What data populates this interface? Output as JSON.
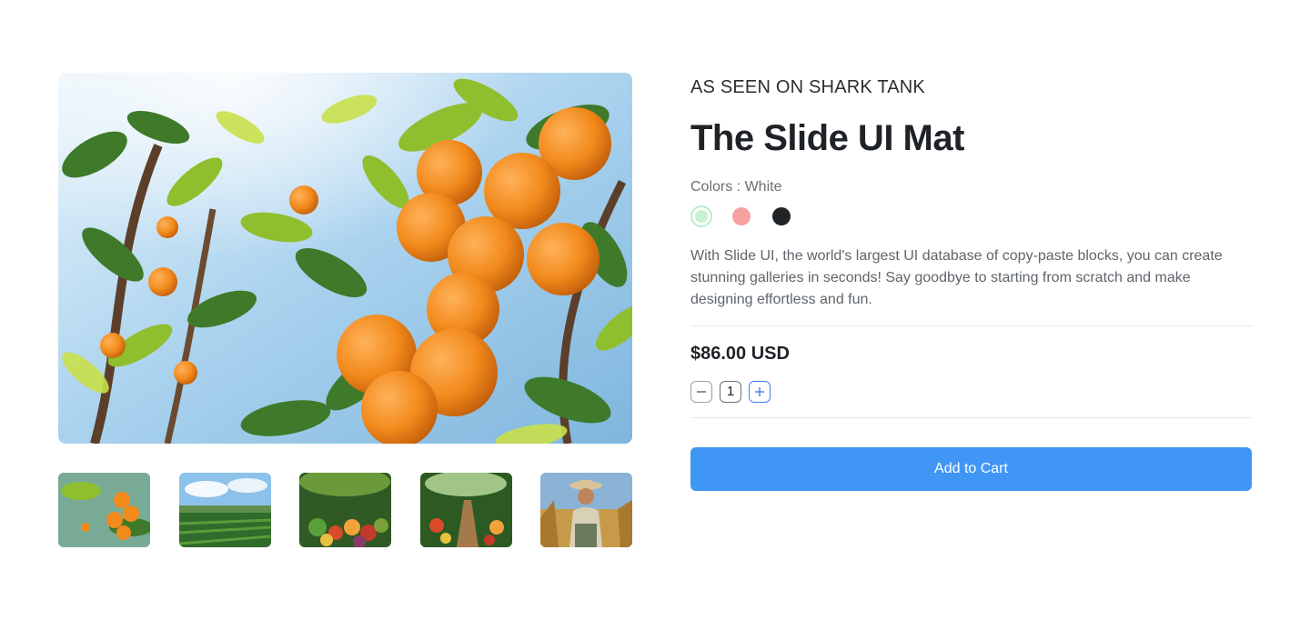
{
  "product": {
    "eyebrow": "AS SEEN ON SHARK TANK",
    "title": "The Slide UI Mat",
    "colors_label": "Colors : White",
    "colors": [
      {
        "name": "White",
        "hex": "#c7f0d2",
        "ring": "#b8ecc7",
        "selected": true
      },
      {
        "name": "Pink",
        "hex": "#f6a1a1",
        "selected": false
      },
      {
        "name": "Black",
        "hex": "#202427",
        "selected": false
      }
    ],
    "description": "With Slide UI, the world's largest UI database of copy-paste blocks, you can create stunning galleries in seconds! Say goodbye to starting from scratch and make designing effortless and fun.",
    "price": "$86.00 USD",
    "quantity": "1",
    "add_to_cart_label": "Add to Cart"
  },
  "gallery": {
    "main_image": "orange-tree-photo",
    "thumbnails": [
      "orange-tree-thumb",
      "farm-field-thumb",
      "vegetable-harvest-thumb",
      "garden-path-thumb",
      "farmer-portrait-thumb"
    ]
  },
  "theme": {
    "accent": "#4096f4",
    "text": "#1f2328",
    "muted": "#5f656b",
    "divider": "#e7e8ea"
  }
}
